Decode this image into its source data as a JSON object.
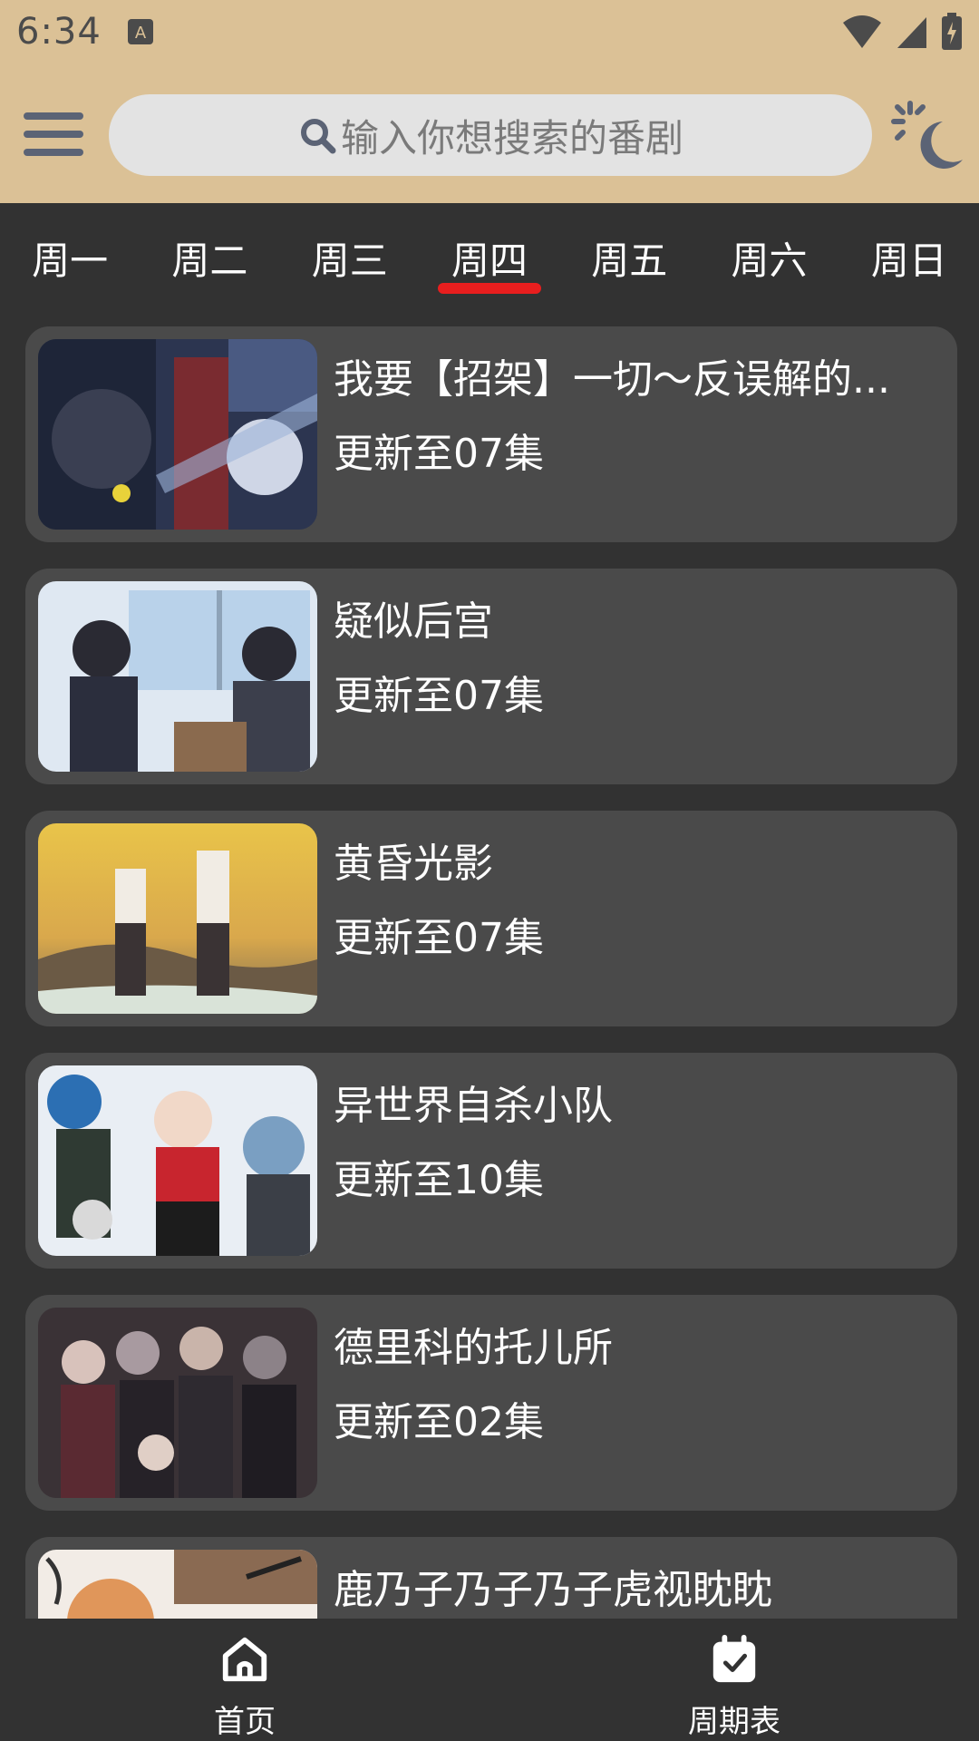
{
  "status_bar": {
    "time": "6:34"
  },
  "app_bar": {
    "search_placeholder": "输入你想搜索的番剧",
    "menu_icon": "hamburger-menu-icon",
    "theme_icon": "sun-moon-theme-icon"
  },
  "tabs": [
    {
      "label": "周一",
      "active": false
    },
    {
      "label": "周二",
      "active": false
    },
    {
      "label": "周三",
      "active": false
    },
    {
      "label": "周四",
      "active": true
    },
    {
      "label": "周五",
      "active": false
    },
    {
      "label": "周六",
      "active": false
    },
    {
      "label": "周日",
      "active": false
    }
  ],
  "shows": [
    {
      "title": "我要【招架】一切～反误解的...",
      "episode": "更新至07集"
    },
    {
      "title": "疑似后宫",
      "episode": "更新至07集"
    },
    {
      "title": "黄昏光影",
      "episode": "更新至07集"
    },
    {
      "title": "异世界自杀小队",
      "episode": "更新至10集"
    },
    {
      "title": "德里科的托儿所",
      "episode": "更新至02集"
    },
    {
      "title": "鹿乃子乃子乃子虎视眈眈",
      "episode": ""
    }
  ],
  "bottom_nav": [
    {
      "label": "首页",
      "icon": "home-icon"
    },
    {
      "label": "周期表",
      "icon": "calendar-check-icon"
    }
  ],
  "colors": {
    "header_bg": "#dbc196",
    "page_bg": "#323232",
    "card_bg": "#4a4a4a",
    "tab_indicator": "#e81e1e",
    "search_bg": "#e3e3e3"
  }
}
